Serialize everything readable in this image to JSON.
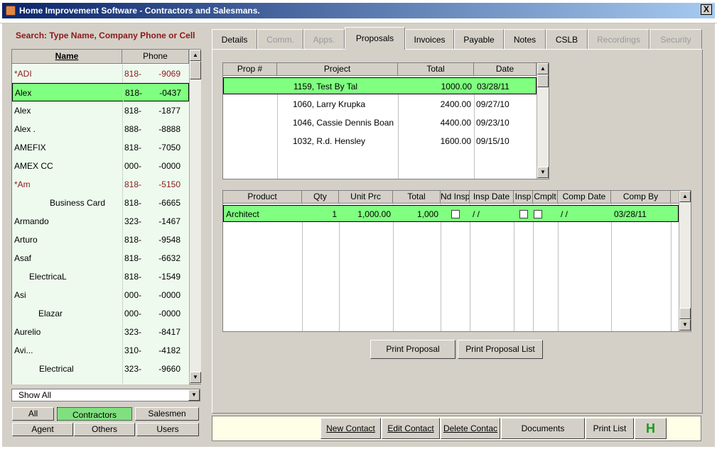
{
  "window": {
    "title": "Home Improvement Software - Contractors and Salesmans.",
    "close_label": "X"
  },
  "search": {
    "label": "Search: Type Name, Company Phone or Cell"
  },
  "contacts": {
    "headers": {
      "name": "Name",
      "phone": "Phone"
    },
    "rows": [
      {
        "name": "*ADI",
        "phone": "818-",
        "phone2": "-9069",
        "red": true
      },
      {
        "name": "Alex",
        "phone": "818-",
        "phone2": "-0437",
        "selected": true
      },
      {
        "name": "Alex",
        "phone": "818-",
        "phone2": "-1877"
      },
      {
        "name": "Alex .",
        "phone": "888-",
        "phone2": "-8888"
      },
      {
        "name": "AMEFIX",
        "phone": "818-",
        "phone2": "-7050"
      },
      {
        "name": "AMEX CC",
        "phone": "000-",
        "phone2": "-0000"
      },
      {
        "name": "*Am",
        "phone": "818-",
        "phone2": "-5150",
        "red": true
      },
      {
        "name": "Business Card",
        "phone": "818-",
        "phone2": "-6665",
        "indent": 50
      },
      {
        "name": "Armando",
        "phone": "323-",
        "phone2": "-1467"
      },
      {
        "name": "Arturo",
        "phone": "818-",
        "phone2": "-9548"
      },
      {
        "name": "Asaf",
        "phone": "818-",
        "phone2": "-6632"
      },
      {
        "name": "ElectricaL",
        "phone": "818-",
        "phone2": "-1549",
        "indent": 21
      },
      {
        "name": "Asi",
        "phone": "000-",
        "phone2": "-0000"
      },
      {
        "name": "Elazar",
        "phone": "000-",
        "phone2": "-0000",
        "indent": 34
      },
      {
        "name": "Aurelio",
        "phone": "323-",
        "phone2": "-8417"
      },
      {
        "name": "Avi...",
        "phone": "310-",
        "phone2": "-4182"
      },
      {
        "name": "Electrical",
        "phone": "323-",
        "phone2": "-9660",
        "indent": 35
      },
      {
        "name": "",
        "phone": "",
        "phone2": ""
      }
    ]
  },
  "filter": {
    "selected": "Show All"
  },
  "categories": {
    "all": "All",
    "contractors": "Contractors",
    "salesmen": "Salesmen",
    "agent": "Agent",
    "others": "Others",
    "users": "Users"
  },
  "tabs": [
    {
      "label": "Details",
      "state": "normal"
    },
    {
      "label": "Comm.",
      "state": "disabled"
    },
    {
      "label": "Apps.",
      "state": "disabled"
    },
    {
      "label": "Proposals",
      "state": "active"
    },
    {
      "label": "Invoices",
      "state": "normal"
    },
    {
      "label": "Payable",
      "state": "normal"
    },
    {
      "label": "Notes",
      "state": "normal"
    },
    {
      "label": "CSLB",
      "state": "normal"
    },
    {
      "label": "Recordings",
      "state": "disabled"
    },
    {
      "label": "Security",
      "state": "disabled"
    }
  ],
  "proposals": {
    "headers": [
      "Prop #",
      "Project",
      "Total",
      "Date"
    ],
    "rows": [
      {
        "prop": "",
        "project": "1159, Test By Tal",
        "total": "1000.00",
        "date": "03/28/11",
        "selected": true
      },
      {
        "prop": "",
        "project": "1060, Larry  Krupka",
        "total": "2400.00",
        "date": "09/27/10"
      },
      {
        "prop": "",
        "project": "1046, Cassie Dennis Boan",
        "total": "4400.00",
        "date": "09/23/10"
      },
      {
        "prop": "",
        "project": "1032, R.d. Hensley",
        "total": "1600.00",
        "date": "09/15/10"
      }
    ]
  },
  "products": {
    "headers": [
      "Product",
      "Qty",
      "Unit Prc",
      "Total",
      "Nd Insp",
      "Insp Date",
      "Insp",
      "Cmplt",
      "Comp Date",
      "Comp By"
    ],
    "rows": [
      {
        "product": "Architect",
        "qty": "1",
        "unit": "1,000.00",
        "total": "1,000",
        "insp_date": "/ /",
        "comp_date": "/ /",
        "comp_by": "03/28/11"
      }
    ]
  },
  "actions": {
    "print_proposal": "Print Proposal",
    "print_proposal_list": "Print Proposal List"
  },
  "bottom": {
    "new_contact": "New Contact",
    "edit_contact": "Edit Contact",
    "delete_contact": "Delete Contac",
    "documents": "Documents",
    "print_list": "Print List",
    "h_label": "H"
  },
  "colors": {
    "selection": "#80ff80",
    "red_text": "#8b1a1a",
    "window_bg": "#d4d0c8",
    "bottom_bar": "#ffffe8"
  }
}
